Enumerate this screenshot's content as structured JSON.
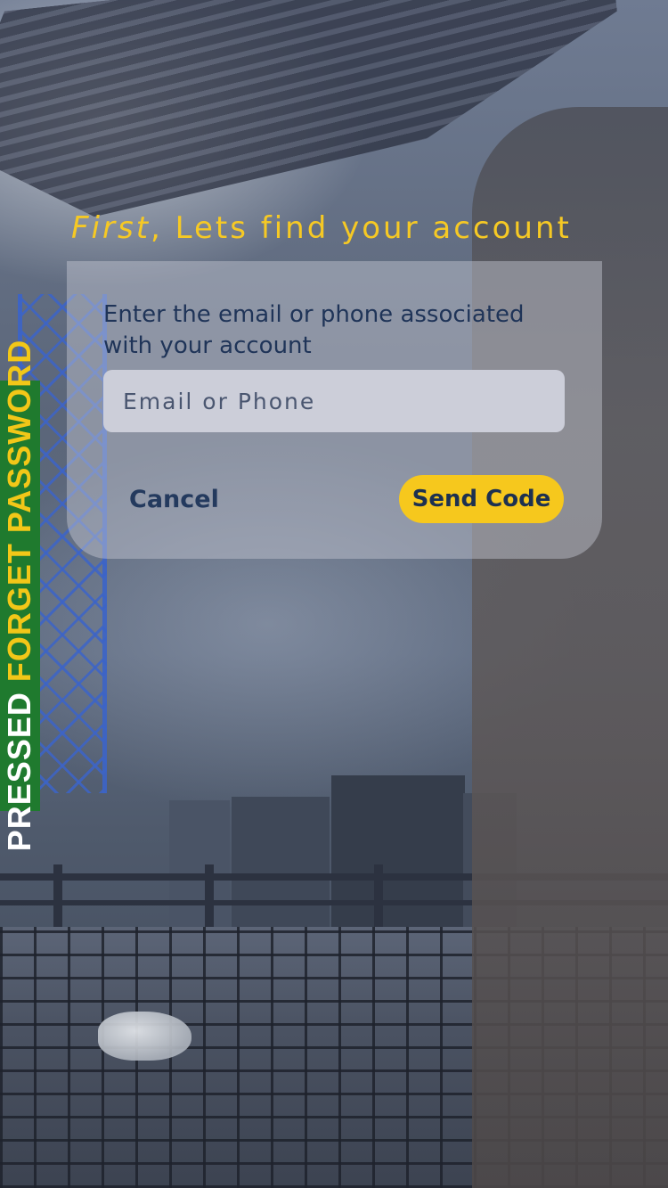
{
  "annotation": {
    "word1": "PRESSED",
    "word2": "FORGET PASSWORD"
  },
  "heading": {
    "emphasis": "First",
    "rest": ", Lets find your account"
  },
  "form": {
    "prompt": "Enter the email or phone associated with your account",
    "input_placeholder": "Email or Phone",
    "input_value": "",
    "cancel_label": "Cancel",
    "send_label": "Send Code"
  },
  "colors": {
    "accent_yellow": "#f6c81d",
    "ribbon_green": "#1f7a2e",
    "text_navy": "#1f3458"
  }
}
